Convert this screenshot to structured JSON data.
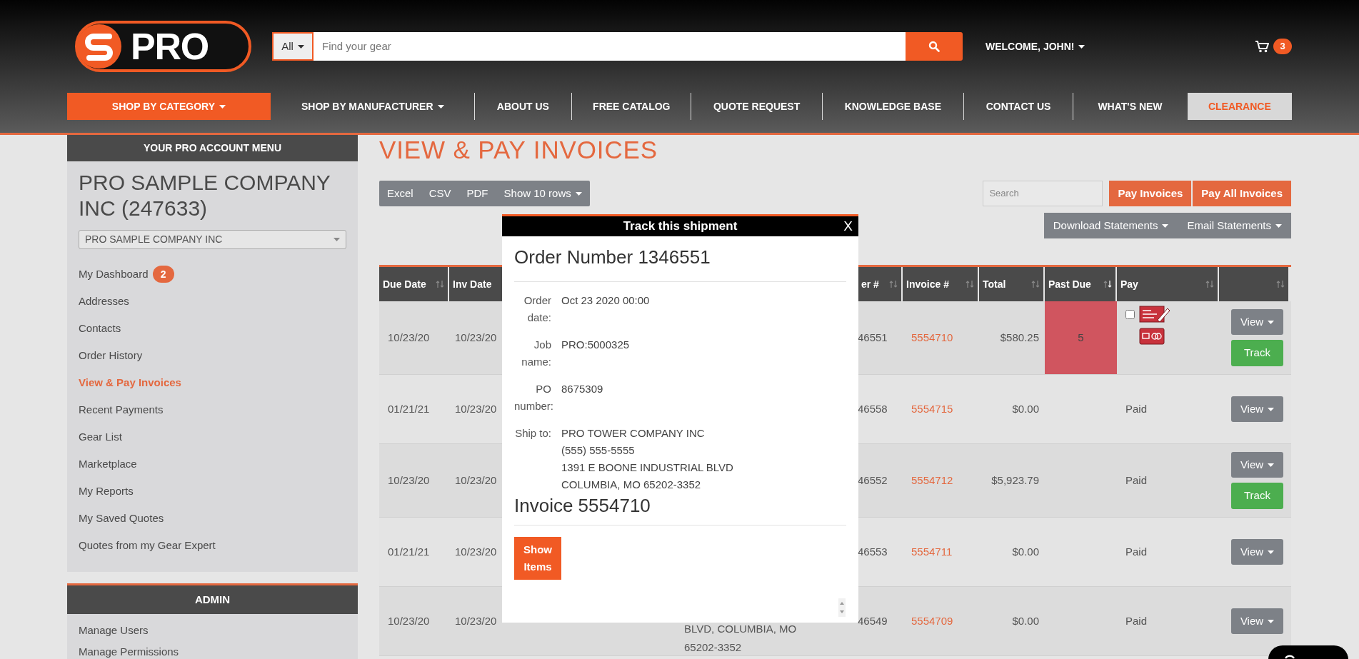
{
  "header": {
    "logo": {
      "text": "PRO"
    },
    "search": {
      "scope": "All",
      "placeholder": "Find your gear"
    },
    "welcome": "WELCOME, JOHN!",
    "cart_count": "3"
  },
  "nav": [
    {
      "label": "SHOP BY CATEGORY",
      "kind": "dropdown",
      "selected": true
    },
    {
      "label": "SHOP BY MANUFACTURER",
      "kind": "dropdown",
      "selected": false
    },
    {
      "label": "ABOUT US",
      "kind": "link",
      "selected": false
    },
    {
      "label": "FREE CATALOG",
      "kind": "link",
      "selected": false
    },
    {
      "label": "QUOTE REQUEST",
      "kind": "link",
      "selected": false
    },
    {
      "label": "KNOWLEDGE BASE",
      "kind": "link",
      "selected": false
    },
    {
      "label": "CONTACT US",
      "kind": "link",
      "selected": false
    },
    {
      "label": "WHAT'S NEW",
      "kind": "link",
      "selected": false
    },
    {
      "label": "CLEARANCE",
      "kind": "clearance",
      "selected": false
    }
  ],
  "sidebar": {
    "title": "YOUR PRO ACCOUNT MENU",
    "company": "PRO SAMPLE COMPANY INC (247633)",
    "account_select": "PRO SAMPLE COMPANY INC",
    "items": [
      {
        "label": "My Dashboard",
        "badge": "2",
        "selected": false
      },
      {
        "label": "Addresses",
        "selected": false
      },
      {
        "label": "Contacts",
        "selected": false
      },
      {
        "label": "Order History",
        "selected": false
      },
      {
        "label": "View & Pay Invoices",
        "selected": true
      },
      {
        "label": "Recent Payments",
        "selected": false
      },
      {
        "label": "Gear List",
        "selected": false
      },
      {
        "label": "Marketplace",
        "selected": false
      },
      {
        "label": "My Reports",
        "selected": false
      },
      {
        "label": "My Saved Quotes",
        "selected": false
      },
      {
        "label": "Quotes from my Gear Expert",
        "selected": false
      }
    ],
    "admin": {
      "title": "ADMIN",
      "items": [
        {
          "label": "Manage Users",
          "selected": false
        },
        {
          "label": "Manage Permissions",
          "selected": false
        }
      ]
    }
  },
  "main": {
    "title": "VIEW & PAY INVOICES",
    "export_buttons": [
      {
        "label": "Excel",
        "kind": "button"
      },
      {
        "label": "CSV",
        "kind": "button"
      },
      {
        "label": "PDF",
        "kind": "button"
      },
      {
        "label": "Show 10 rows",
        "kind": "dropdown"
      }
    ],
    "search": {
      "placeholder": "Search"
    },
    "pay_buttons": [
      "Pay Invoices",
      "Pay All Invoices"
    ],
    "statement_buttons": [
      "Download Statements",
      "Email Statements"
    ],
    "table": {
      "columns": [
        {
          "label": "Due Date",
          "sorted": false
        },
        {
          "label": "Inv Date"
        },
        {
          "label": "er #",
          "sorted": false
        },
        {
          "label": "Invoice #",
          "sorted": false
        },
        {
          "label": "Total",
          "sorted": false
        },
        {
          "label": "Past Due",
          "sorted": true
        },
        {
          "label": "Pay",
          "sorted": false
        },
        {
          "sorted": false
        }
      ],
      "rows": [
        {
          "due_date": "10/23/20",
          "inv_date": "10/23/20",
          "order": "46551",
          "invoice": "5554710",
          "total": "$580.25",
          "past_due": "5",
          "overdue": true,
          "pay": {
            "kind": "options",
            "checked": false
          },
          "actions": [
            {
              "label": "View",
              "kind": "dropdown"
            },
            {
              "label": "Track",
              "kind": "track"
            }
          ]
        },
        {
          "due_date": "01/21/21",
          "inv_date": "10/23/20",
          "order": "46558",
          "invoice": "5554715",
          "total": "$0.00",
          "overdue": false,
          "pay": {
            "kind": "text",
            "text": "Paid"
          },
          "actions": [
            {
              "label": "View",
              "kind": "dropdown"
            }
          ]
        },
        {
          "due_date": "10/23/20",
          "inv_date": "10/23/20",
          "order": "46552",
          "invoice": "5554712",
          "total": "$5,923.79",
          "overdue": false,
          "pay": {
            "kind": "text",
            "text": "Paid"
          },
          "actions": [
            {
              "label": "View",
              "kind": "dropdown"
            },
            {
              "label": "Track",
              "kind": "track"
            }
          ]
        },
        {
          "due_date": "01/21/21",
          "inv_date": "10/23/20",
          "order": "46553",
          "invoice": "5554711",
          "total": "$0.00",
          "overdue": false,
          "pay": {
            "kind": "text",
            "text": "Paid"
          },
          "actions": [
            {
              "label": "View",
              "kind": "dropdown"
            }
          ]
        },
        {
          "due_date": "10/23/20",
          "inv_date": "10/23/20",
          "address": [
            "BLVD, COLUMBIA, MO",
            "65202-3352"
          ],
          "order": "46549",
          "invoice": "5554709",
          "total": "$0.00",
          "overdue": false,
          "pay": {
            "kind": "text",
            "text": "Paid"
          },
          "actions": [
            {
              "label": "View",
              "kind": "dropdown"
            }
          ]
        }
      ]
    }
  },
  "modal": {
    "title": "Track this shipment",
    "close": "X",
    "order_heading": "Order Number 1346551",
    "fields": [
      {
        "label": "Order date:",
        "values": [
          "Oct 23 2020 00:00"
        ]
      },
      {
        "label": "Job name:",
        "values": [
          "PRO:5000325"
        ]
      },
      {
        "label": "PO number:",
        "values": [
          "8675309"
        ]
      },
      {
        "label": "Ship to:",
        "values": [
          "PRO TOWER COMPANY INC",
          "(555) 555-5555",
          "1391 E BOONE INDUSTRIAL BLVD",
          "COLUMBIA, MO 65202-3352"
        ]
      }
    ],
    "invoice_heading": "Invoice 5554710",
    "button": "Show Items"
  }
}
